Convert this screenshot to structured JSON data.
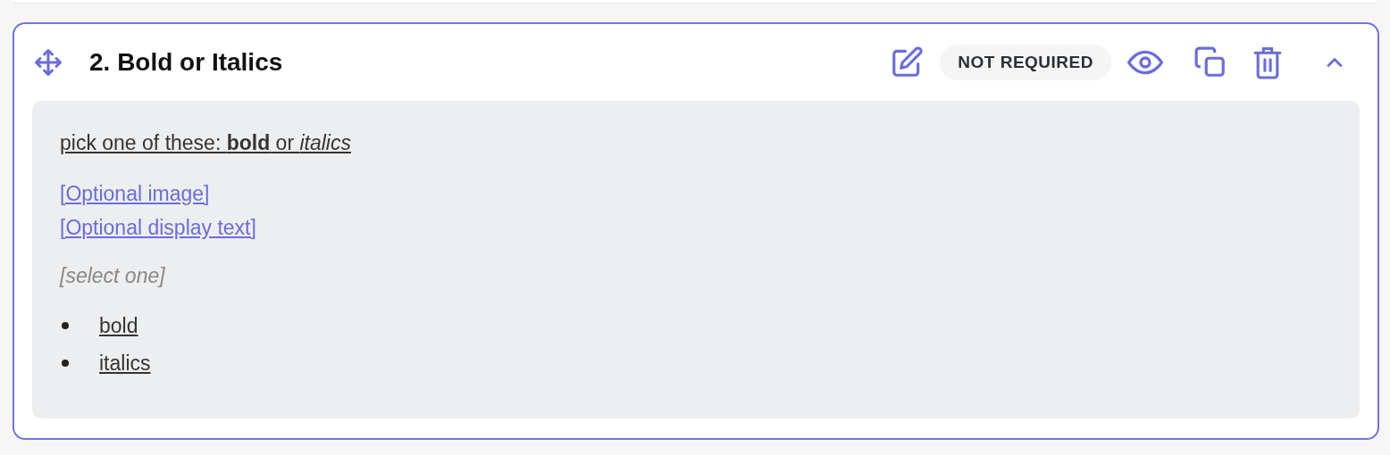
{
  "question": {
    "title": "2. Bold or Italics",
    "badge": "NOT REQUIRED",
    "expanded": true,
    "prompt": "pick one of these: **bold** or *italics*",
    "links": [
      "[Optional image]",
      "[Optional display text]"
    ],
    "instruction": "[select one]",
    "options": [
      "bold",
      "italics"
    ]
  }
}
